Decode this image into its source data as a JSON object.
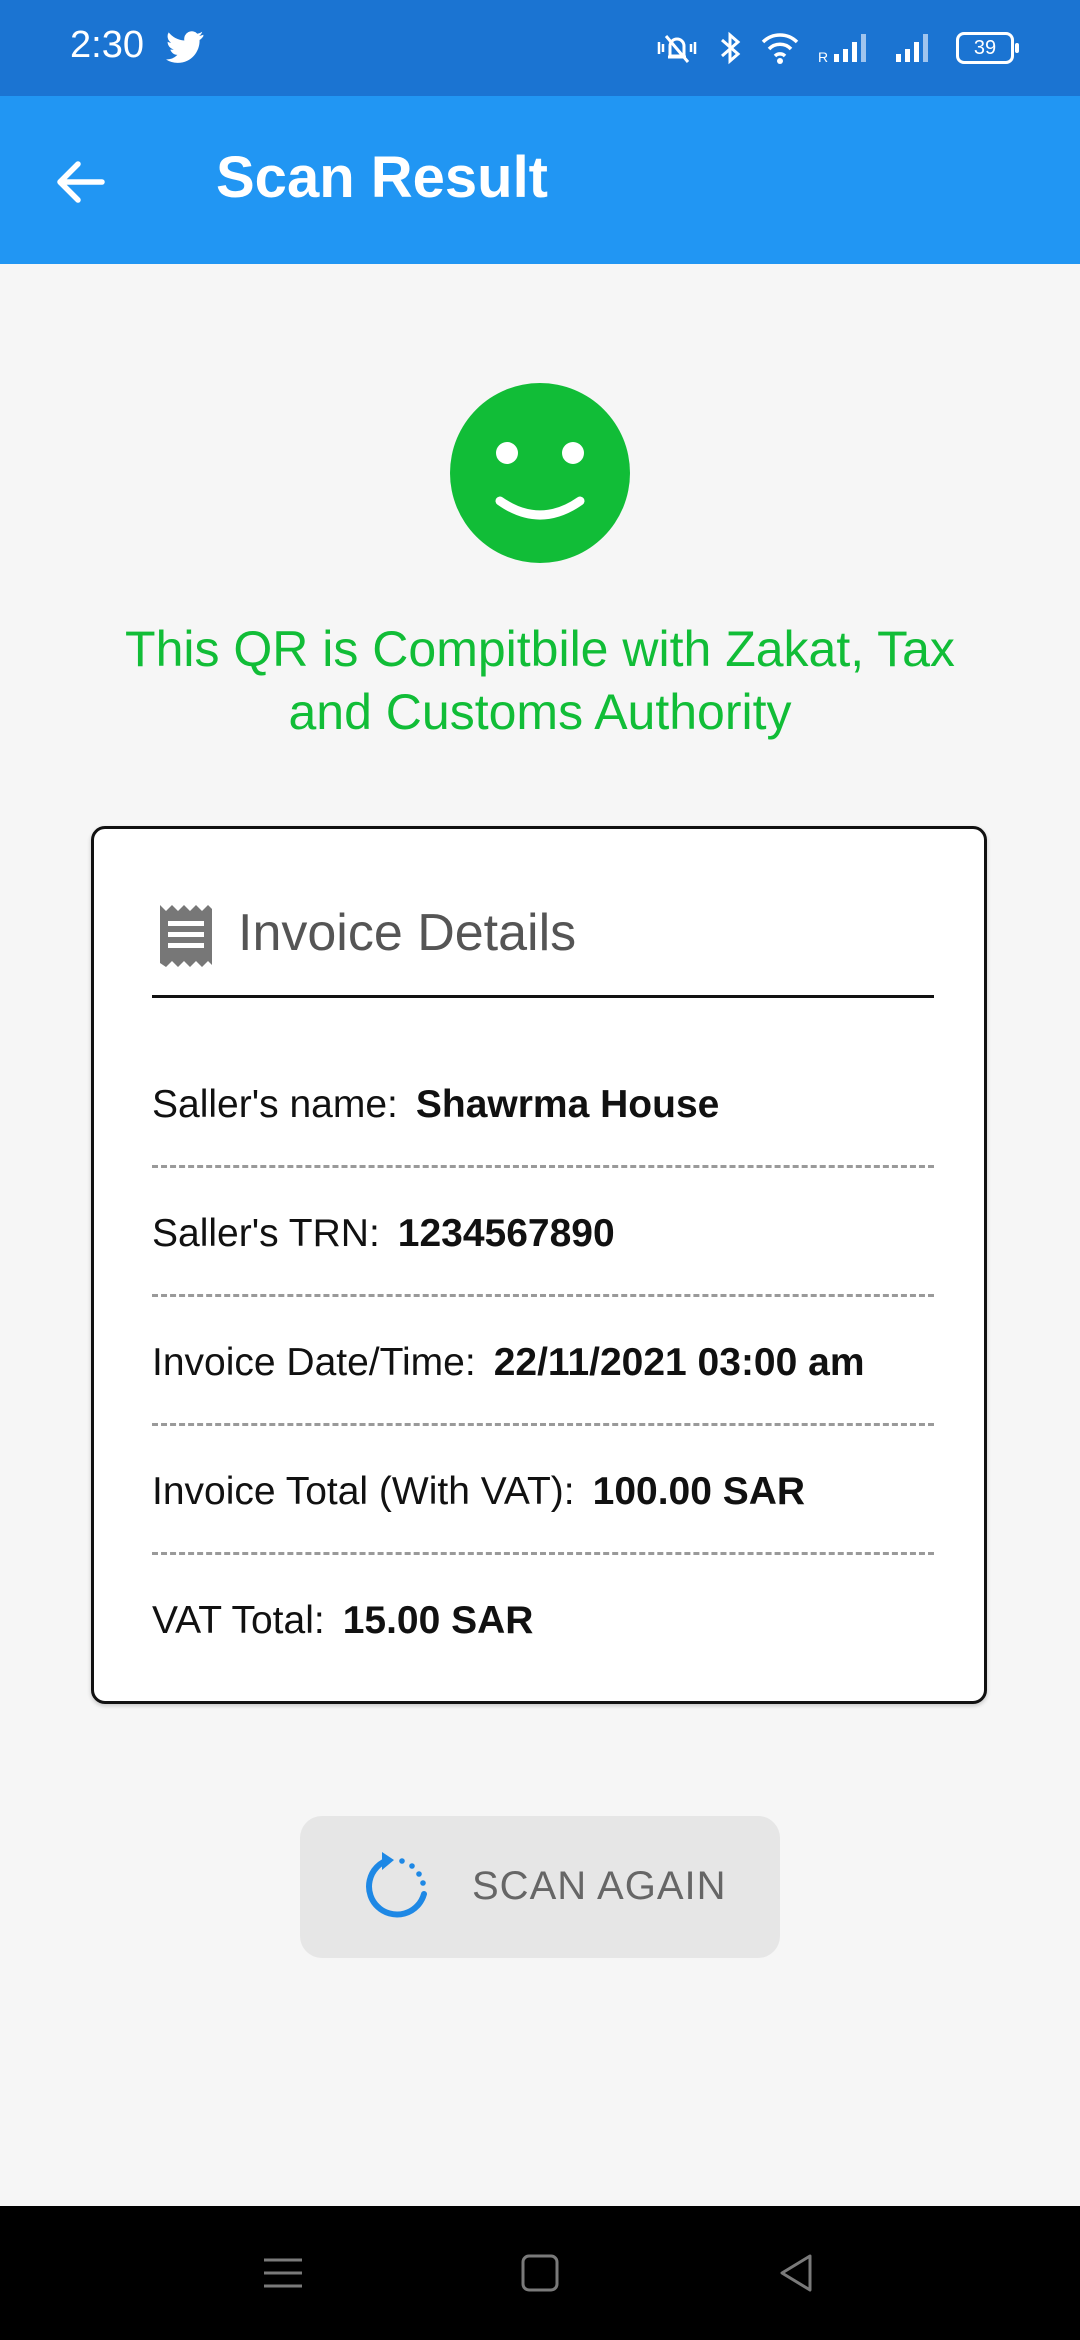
{
  "status": {
    "time": "2:30",
    "battery": "39",
    "network_label": "R",
    "icons": [
      "twitter-icon",
      "vibrate-icon",
      "bluetooth-icon",
      "wifi-icon",
      "signal-icon",
      "signal-icon",
      "battery-icon"
    ]
  },
  "appbar": {
    "title": "Scan Result",
    "back_icon": "arrow-left-icon",
    "color": "#2196f3"
  },
  "result": {
    "icon": "smiley-face-icon",
    "message": "This QR is Compitbile with Zakat, Tax and Customs Authority",
    "color": "#11bd37"
  },
  "invoice": {
    "title": "Invoice Details",
    "icon": "receipt-icon",
    "rows": [
      {
        "label": "Saller's name:",
        "value": "Shawrma House"
      },
      {
        "label": "Saller's TRN:",
        "value": "1234567890"
      },
      {
        "label": "Invoice Date/Time:",
        "value": "22/11/2021 03:00 am"
      },
      {
        "label": "Invoice Total (With VAT):",
        "value": "100.00 SAR"
      },
      {
        "label": "VAT Total:",
        "value": "15.00 SAR"
      }
    ]
  },
  "actions": {
    "scan_again_label": "SCAN AGAIN",
    "scan_again_icon": "refresh-icon"
  },
  "navigation": {
    "icons": [
      "menu-icon",
      "home-square-icon",
      "back-triangle-icon"
    ]
  }
}
